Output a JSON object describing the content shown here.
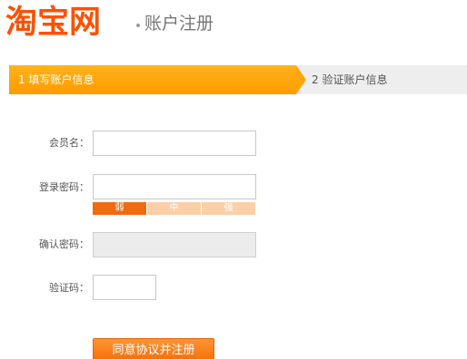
{
  "header": {
    "logo_text": "淘宝网",
    "title": "账户注册"
  },
  "steps": [
    {
      "label": "1 填写账户信息",
      "active": true
    },
    {
      "label": "2 验证账户信息",
      "active": false
    }
  ],
  "form": {
    "username": {
      "label": "会员名：",
      "value": ""
    },
    "password": {
      "label": "登录密码：",
      "value": "",
      "strength_levels": [
        "弱",
        "中",
        "强"
      ],
      "strength_current": "弱"
    },
    "confirm_password": {
      "label": "确认密码：",
      "value": ""
    },
    "captcha": {
      "label": "验证码：",
      "value": ""
    },
    "submit_label": "同意协议并注册"
  },
  "colors": {
    "brand": "#ff5000",
    "step_active": "#ffa60b",
    "strength_active": "#f06a10",
    "strength_inactive": "#fbcfa8",
    "button": "#f57a14"
  }
}
